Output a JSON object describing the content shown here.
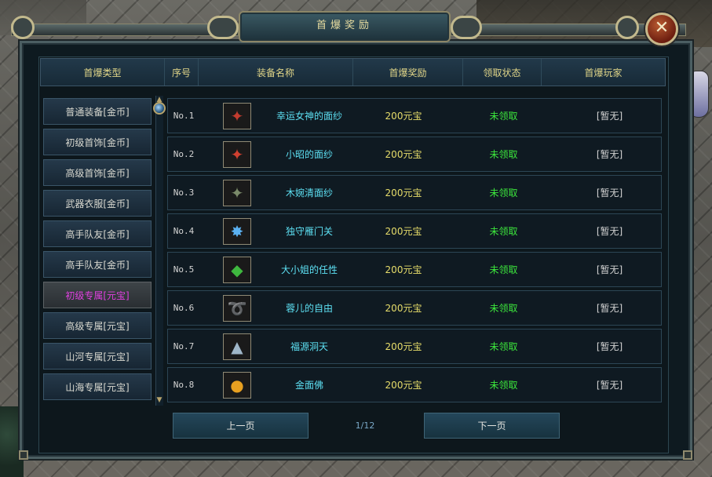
{
  "window": {
    "title": "首爆奖励",
    "close_symbol": "✕"
  },
  "header": {
    "columns": [
      "首爆类型",
      "序号",
      "装备名称",
      "首爆奖励",
      "领取状态",
      "首爆玩家"
    ]
  },
  "sidebar": {
    "active_index": 6,
    "items": [
      {
        "label": "普通装备[金币]"
      },
      {
        "label": "初级首饰[金币]"
      },
      {
        "label": "高级首饰[金币]"
      },
      {
        "label": "武器衣服[金币]"
      },
      {
        "label": "高手队友[金币]"
      },
      {
        "label": "高手队友[金币]"
      },
      {
        "label": "初级专属[元宝]"
      },
      {
        "label": "高级专属[元宝]"
      },
      {
        "label": "山河专属[元宝]"
      },
      {
        "label": "山海专属[元宝]"
      }
    ]
  },
  "rows": [
    {
      "no": "No.1",
      "icon": "mask-icon",
      "icon_glyph": "✦",
      "icon_color": "#c23b2e",
      "name": "幸运女神的面纱",
      "reward": "200元宝",
      "status": "未领取",
      "player": "[暂无]"
    },
    {
      "no": "No.2",
      "icon": "mask-icon",
      "icon_glyph": "✦",
      "icon_color": "#d04030",
      "name": "小昭的面纱",
      "reward": "200元宝",
      "status": "未领取",
      "player": "[暂无]"
    },
    {
      "no": "No.3",
      "icon": "mask-icon",
      "icon_glyph": "✦",
      "icon_color": "#7a8a6a",
      "name": "木婉清面纱",
      "reward": "200元宝",
      "status": "未领取",
      "player": "[暂无]"
    },
    {
      "no": "No.4",
      "icon": "star-gem-icon",
      "icon_glyph": "✸",
      "icon_color": "#5ab0f0",
      "name": "独守雁门关",
      "reward": "200元宝",
      "status": "未领取",
      "player": "[暂无]"
    },
    {
      "no": "No.5",
      "icon": "green-gem-icon",
      "icon_glyph": "◆",
      "icon_color": "#3fb83f",
      "name": "大小姐的任性",
      "reward": "200元宝",
      "status": "未领取",
      "player": "[暂无]"
    },
    {
      "no": "No.6",
      "icon": "whip-icon",
      "icon_glyph": "➰",
      "icon_color": "#a8b890",
      "name": "蓉儿的自由",
      "reward": "200元宝",
      "status": "未领取",
      "player": "[暂无]"
    },
    {
      "no": "No.7",
      "icon": "crystal-icon",
      "icon_glyph": "▲",
      "icon_color": "#9fb6c8",
      "name": "福源洞天",
      "reward": "200元宝",
      "status": "未领取",
      "player": "[暂无]"
    },
    {
      "no": "No.8",
      "icon": "golden-buddha-icon",
      "icon_glyph": "●",
      "icon_color": "#e8a020",
      "name": "金面佛",
      "reward": "200元宝",
      "status": "未领取",
      "player": "[暂无]"
    }
  ],
  "pager": {
    "prev_label": "上一页",
    "next_label": "下一页",
    "page_info": "1/12"
  }
}
